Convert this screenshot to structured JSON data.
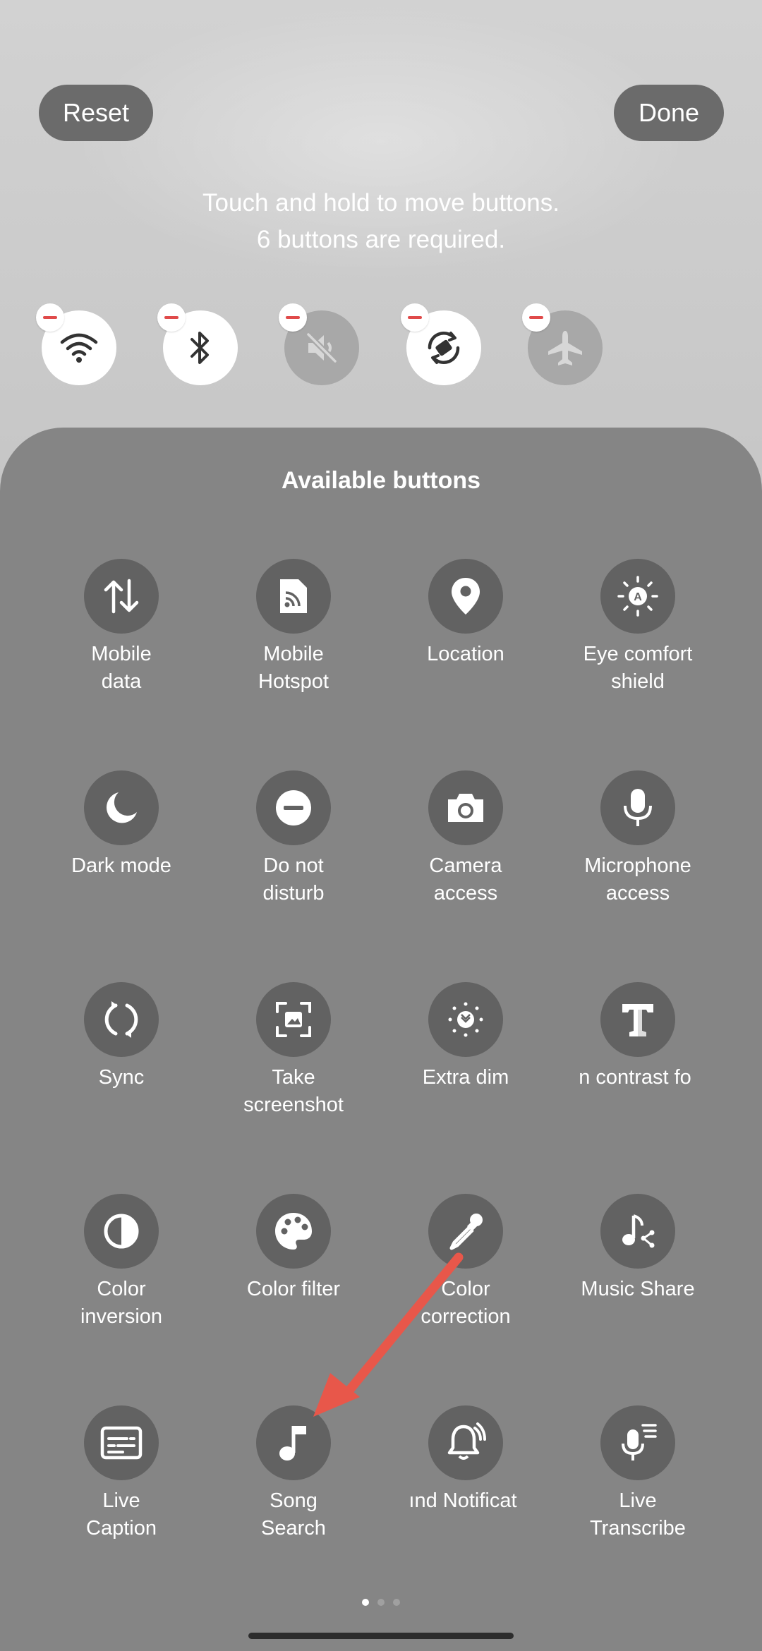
{
  "header": {
    "reset_label": "Reset",
    "done_label": "Done",
    "hint_line1": "Touch and hold to move buttons.",
    "hint_line2": "6 buttons are required."
  },
  "active_buttons": [
    {
      "name": "wifi-icon",
      "state": "on"
    },
    {
      "name": "bluetooth-icon",
      "state": "on"
    },
    {
      "name": "sound-muted-icon",
      "state": "off"
    },
    {
      "name": "auto-rotate-icon",
      "state": "on"
    },
    {
      "name": "airplane-mode-icon",
      "state": "off"
    }
  ],
  "panel": {
    "title": "Available buttons",
    "items": [
      {
        "label": "Mobile\ndata",
        "icon": "mobile-data-icon"
      },
      {
        "label": "Mobile\nHotspot",
        "icon": "hotspot-icon"
      },
      {
        "label": "Location",
        "icon": "location-icon"
      },
      {
        "label": "Eye comfort\nshield",
        "icon": "eye-comfort-icon"
      },
      {
        "label": "Dark mode",
        "icon": "moon-icon"
      },
      {
        "label": "Do not\ndisturb",
        "icon": "do-not-disturb-icon"
      },
      {
        "label": "Camera\naccess",
        "icon": "camera-icon"
      },
      {
        "label": "Microphone\naccess",
        "icon": "microphone-icon"
      },
      {
        "label": "Sync",
        "icon": "sync-icon"
      },
      {
        "label": "Take\nscreenshot",
        "icon": "screenshot-icon"
      },
      {
        "label": "Extra dim",
        "icon": "extra-dim-icon"
      },
      {
        "label": "n contrast fo",
        "icon": "high-contrast-font-icon"
      },
      {
        "label": "Color\ninversion",
        "icon": "color-inversion-icon"
      },
      {
        "label": "Color filter",
        "icon": "palette-icon"
      },
      {
        "label": "Color\ncorrection",
        "icon": "eyedropper-icon"
      },
      {
        "label": "Music Share",
        "icon": "music-share-icon"
      },
      {
        "label": "Live\nCaption",
        "icon": "caption-icon"
      },
      {
        "label": "Song\nSearch",
        "icon": "music-note-icon"
      },
      {
        "label": "ınd Notificat",
        "icon": "sound-notification-icon"
      },
      {
        "label": "Live\nTranscribe",
        "icon": "transcribe-icon"
      }
    ]
  },
  "pager": {
    "pages": 3,
    "current": 1
  },
  "colors": {
    "arrow": "#e8574a",
    "panel": "#858585",
    "tile": "#626262"
  }
}
